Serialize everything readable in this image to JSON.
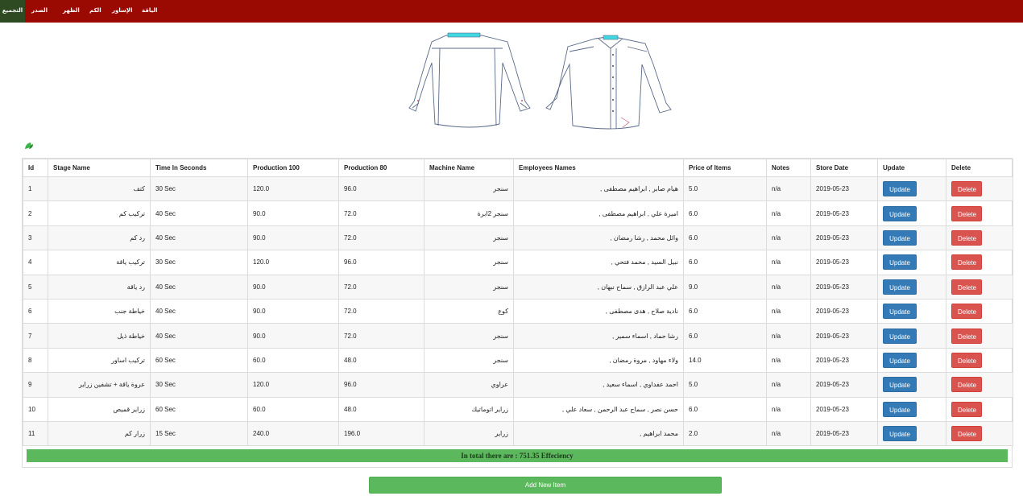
{
  "nav": {
    "active_label": "التجميع",
    "items": [
      "الصدر",
      "الظهر",
      "الكم",
      "الإساور",
      "الياقة"
    ]
  },
  "table": {
    "headers": [
      "Id",
      "Stage Name",
      "Time In Seconds",
      "Production 100",
      "Production 80",
      "Machine Name",
      "Employees Names",
      "Price of Items",
      "Notes",
      "Store Date",
      "Update",
      "Delete"
    ],
    "rows": [
      {
        "id": "1",
        "stage": "كتف",
        "time": "30 Sec",
        "p100": "120.0",
        "p80": "96.0",
        "machine": "سنجر",
        "employees": "هيام صابر , ابراهيم مصطفى ,",
        "price": "5.0",
        "notes": "n/a",
        "date": "2019-05-23"
      },
      {
        "id": "2",
        "stage": "تركيب كم",
        "time": "40 Sec",
        "p100": "90.0",
        "p80": "72.0",
        "machine": "سنجر 2ابرة",
        "employees": "اميرة علي , ابراهيم مصطفى ,",
        "price": "6.0",
        "notes": "n/a",
        "date": "2019-05-23"
      },
      {
        "id": "3",
        "stage": "رد كم",
        "time": "40 Sec",
        "p100": "90.0",
        "p80": "72.0",
        "machine": "سنجر",
        "employees": "وائل محمد , رشا رمضان ,",
        "price": "6.0",
        "notes": "n/a",
        "date": "2019-05-23"
      },
      {
        "id": "4",
        "stage": "تركيب ياقة",
        "time": "30 Sec",
        "p100": "120.0",
        "p80": "96.0",
        "machine": "سنجر",
        "employees": "نبيل السيد , محمد فتحي ,",
        "price": "6.0",
        "notes": "n/a",
        "date": "2019-05-23"
      },
      {
        "id": "5",
        "stage": "رد ياقة",
        "time": "40 Sec",
        "p100": "90.0",
        "p80": "72.0",
        "machine": "سنجر",
        "employees": "علي عبد الرازق , سماح نبهان ,",
        "price": "9.0",
        "notes": "n/a",
        "date": "2019-05-23"
      },
      {
        "id": "6",
        "stage": "خياطة جنب",
        "time": "40 Sec",
        "p100": "90.0",
        "p80": "72.0",
        "machine": "كوع",
        "employees": "نادية صلاح , هدى مصطفى ,",
        "price": "6.0",
        "notes": "n/a",
        "date": "2019-05-23"
      },
      {
        "id": "7",
        "stage": "خياطة ذيل",
        "time": "40 Sec",
        "p100": "90.0",
        "p80": "72.0",
        "machine": "سنجر",
        "employees": "رشا حماد , اسماء سمير ,",
        "price": "6.0",
        "notes": "n/a",
        "date": "2019-05-23"
      },
      {
        "id": "8",
        "stage": "تركيب اساور",
        "time": "60 Sec",
        "p100": "60.0",
        "p80": "48.0",
        "machine": "سنجر",
        "employees": "ولاء مهاود , مروة رمضان ,",
        "price": "14.0",
        "notes": "n/a",
        "date": "2019-05-23"
      },
      {
        "id": "9",
        "stage": "عروة ياقة + تشفين زراير",
        "time": "30 Sec",
        "p100": "120.0",
        "p80": "96.0",
        "machine": "عراوي",
        "employees": "احمد عفداوي , اسماء سعيد ,",
        "price": "5.0",
        "notes": "n/a",
        "date": "2019-05-23"
      },
      {
        "id": "10",
        "stage": "زراير قميص",
        "time": "60 Sec",
        "p100": "60.0",
        "p80": "48.0",
        "machine": "زراير اتوماتيك",
        "employees": "حسن نصر , سماح عبد الرحمن , سعاد علي ,",
        "price": "6.0",
        "notes": "n/a",
        "date": "2019-05-23"
      },
      {
        "id": "11",
        "stage": "زرار كم",
        "time": "15 Sec",
        "p100": "240.0",
        "p80": "196.0",
        "machine": "زراير",
        "employees": "محمد ابراهيم ,",
        "price": "2.0",
        "notes": "n/a",
        "date": "2019-05-23"
      }
    ],
    "update_label": "Update",
    "delete_label": "Delete"
  },
  "total": "In total there are : 751.35 Effeciency",
  "add_label": "Add New Item",
  "colors": {
    "navbar": "#9a0a03",
    "nav_active": "#2d4a22",
    "update": "#337ab7",
    "delete": "#d9534f",
    "success": "#5cb85c"
  }
}
